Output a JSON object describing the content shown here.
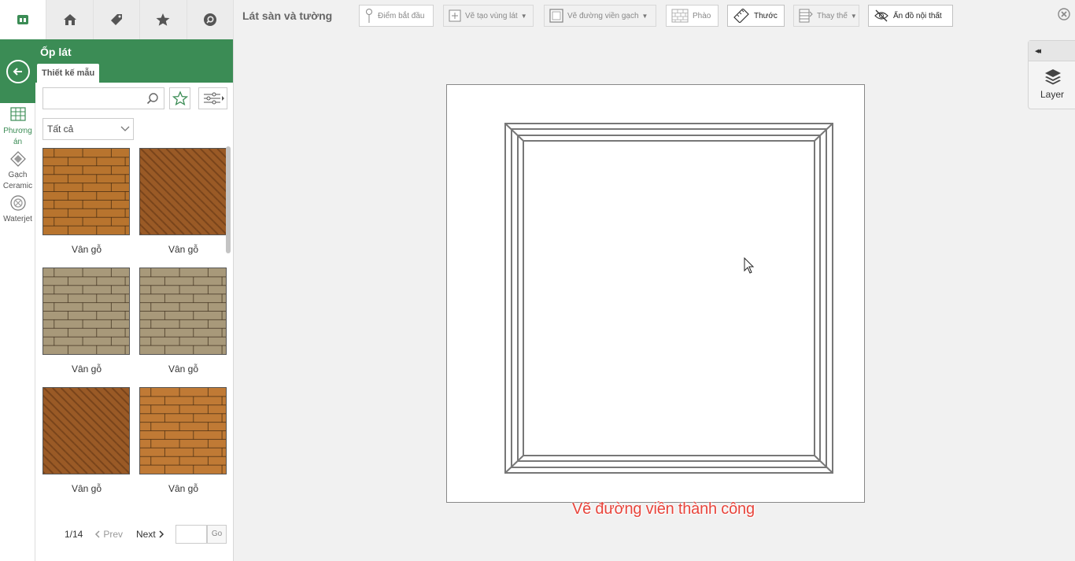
{
  "toolbar": {
    "title": "Lát sàn và tường",
    "start_point": "Điểm bắt đầu",
    "create_area": "Vẽ tạo vùng lát",
    "draw_border": "Vẽ đường viền gạch",
    "molding": "Phào",
    "ruler": "Thước",
    "replace": "Thay thế",
    "hide_furniture": "Ẩn đồ nội thất"
  },
  "sidebar": {
    "top_icons": [
      "logo-icon",
      "house-icon",
      "tag-icon",
      "star-icon",
      "search-circle-icon"
    ],
    "panel_title": "Ốp lát",
    "panel_tab": "Thiết kế mẫu",
    "categories": [
      {
        "label": "Phương án",
        "icon": "grid-icon"
      },
      {
        "label": "Gạch Ceramic",
        "icon": "diamond-tile-icon"
      },
      {
        "label": "Waterjet",
        "icon": "waterjet-icon"
      }
    ],
    "search_placeholder": "",
    "filter_select": "Tất cả",
    "tiles": [
      {
        "label": "Vân gỗ",
        "pattern": "brick",
        "color": "#b8742e"
      },
      {
        "label": "Vân gỗ",
        "pattern": "herringbone",
        "color": "#9a5a26"
      },
      {
        "label": "Vân gỗ",
        "pattern": "brick",
        "color": "#a8997a"
      },
      {
        "label": "Vân gỗ",
        "pattern": "brick",
        "color": "#a8997a"
      },
      {
        "label": "Vân gỗ",
        "pattern": "herringbone",
        "color": "#9a5a26"
      },
      {
        "label": "Vân gỗ",
        "pattern": "brick",
        "color": "#c07a35"
      }
    ],
    "pager": {
      "page": "1/14",
      "prev": "Prev",
      "next": "Next",
      "page_input": "",
      "go": "Go"
    }
  },
  "canvas": {
    "status_message": "Vẽ đường viền thành công"
  },
  "layer_panel": {
    "collapse": "◂◂",
    "label": "Layer"
  },
  "colors": {
    "brand_green": "#3b8c55",
    "status_red": "#e8453c"
  }
}
